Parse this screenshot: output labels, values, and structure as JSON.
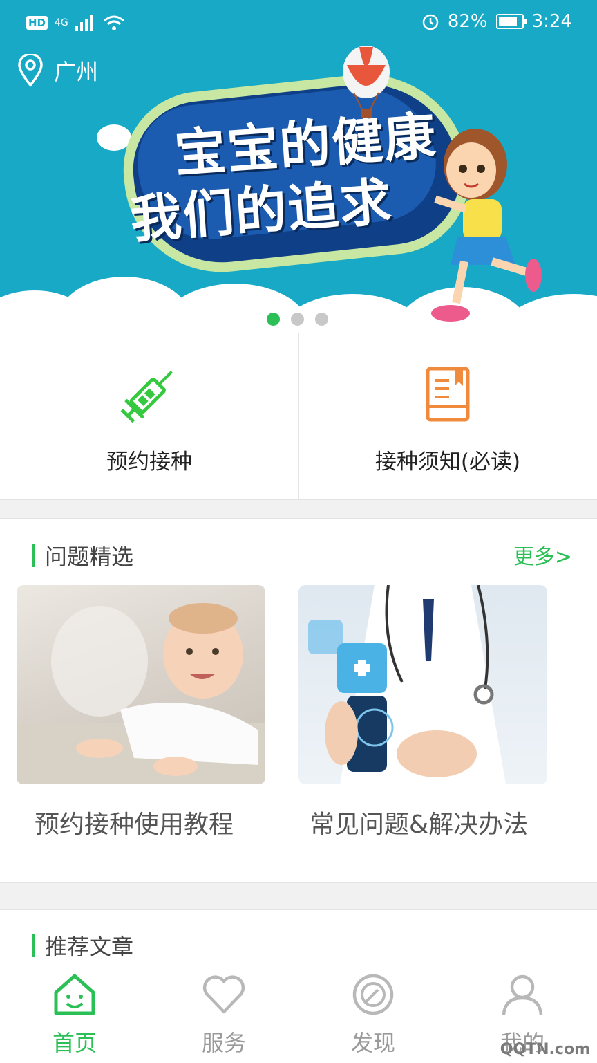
{
  "status_bar": {
    "hd": "HD",
    "network": "4G",
    "battery_pct": "82%",
    "time": "3:24"
  },
  "location": {
    "city": "广州"
  },
  "banner": {
    "line1": "宝宝的健康",
    "line2": "我们的追求",
    "active_slide": 1,
    "slide_count": 3
  },
  "quick_actions": [
    {
      "label": "预约接种",
      "icon": "syringe-icon",
      "color": "#35c93f"
    },
    {
      "label": "接种须知(必读)",
      "icon": "book-icon",
      "color": "#f08a3c"
    }
  ],
  "questions": {
    "title": "问题精选",
    "more": "更多>",
    "cards": [
      {
        "title": "预约接种使用教程",
        "image": "baby-photo"
      },
      {
        "title": "常见问题&解决办法",
        "image": "doctor-photo"
      }
    ]
  },
  "articles": {
    "title": "推荐文章"
  },
  "tabbar": [
    {
      "label": "首页",
      "icon": "home-icon",
      "active": true
    },
    {
      "label": "服务",
      "icon": "heart-icon",
      "active": false
    },
    {
      "label": "发现",
      "icon": "compass-icon",
      "active": false
    },
    {
      "label": "我的",
      "icon": "user-icon",
      "active": false
    }
  ],
  "watermark": "QQTN.com",
  "colors": {
    "accent": "#2bc056",
    "banner": "#18a9c6",
    "orange": "#f08a3c"
  }
}
